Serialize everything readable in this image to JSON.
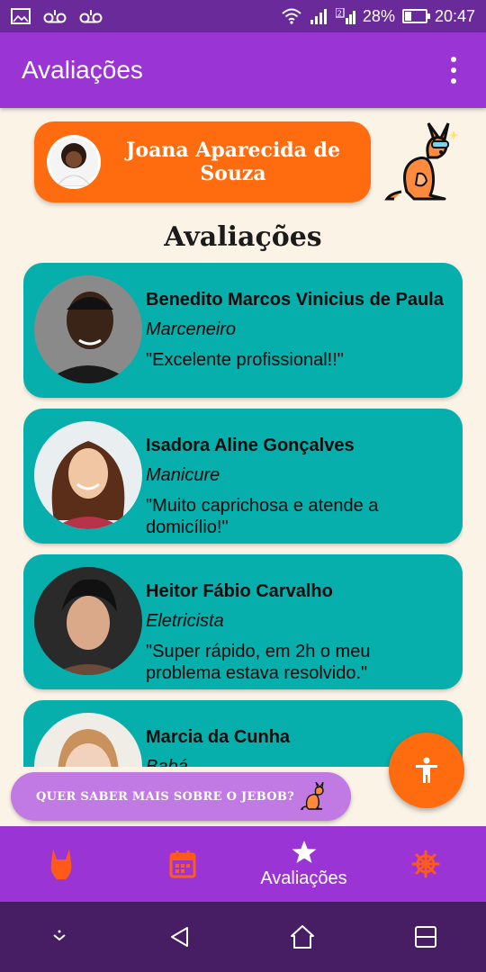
{
  "status_bar": {
    "icons": [
      "gallery-icon",
      "voicemail-icon",
      "voicemail-icon",
      "wifi-icon",
      "signal-icon",
      "sim2-signal-icon",
      "battery-icon"
    ],
    "battery_percent": "28%",
    "battery_level": 0.28,
    "time": "20:47"
  },
  "app_bar": {
    "title": "Avaliações",
    "menu_icon": "more-vert-icon"
  },
  "profile": {
    "name": "Joana Aparecida de Souza",
    "avatar_icon": "avatar"
  },
  "section_title": "Avaliações",
  "reviews": [
    {
      "name": "Benedito Marcos Vinicius de Paula",
      "profession": "Marceneiro",
      "comment": "\"Excelente profissional!!\""
    },
    {
      "name": "Isadora Aline Gonçalves",
      "profession": "Manicure",
      "comment": "\"Muito caprichosa e atende a domicílio!\""
    },
    {
      "name": "Heitor Fábio Carvalho",
      "profession": "Eletricista",
      "comment": "\"Super rápido, em 2h o meu problema estava resolvido.\""
    },
    {
      "name": "Marcia da Cunha",
      "profession": "Babá",
      "comment": ""
    }
  ],
  "info_pill": {
    "text": "QUER SABER MAIS SOBRE O JEBOB?"
  },
  "fab": {
    "icon": "accessibility-icon"
  },
  "bottom_nav": {
    "items": [
      {
        "icon": "kangaroo-icon",
        "label": ""
      },
      {
        "icon": "calendar-icon",
        "label": ""
      },
      {
        "icon": "star-icon",
        "label": "Avaliações"
      },
      {
        "icon": "helm-icon",
        "label": ""
      }
    ]
  },
  "colors": {
    "status_bar": "#6b2a99",
    "primary": "#9b34d5",
    "accent": "#ff6b0f",
    "card": "#06aeac",
    "background": "#fbf3e6",
    "info_pill": "#c179e3",
    "system_nav": "#471d63"
  }
}
